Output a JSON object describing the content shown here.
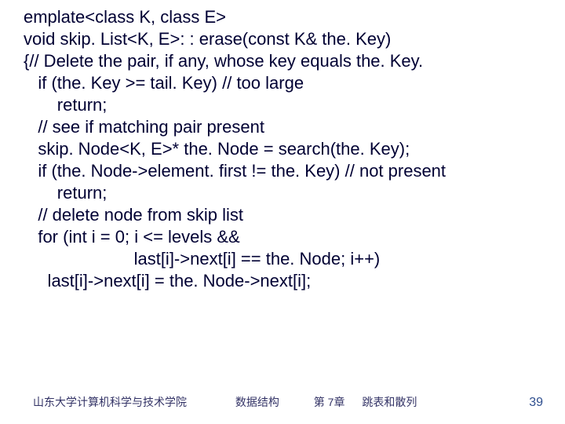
{
  "code": {
    "l01": "emplate<class K, class E>",
    "l02": "void skip. List<K, E>: : erase(const K& the. Key)",
    "l03": "{// Delete the pair, if any, whose key equals the. Key.",
    "l04": "   if (the. Key >= tail. Key) // too large",
    "l05": "       return;",
    "l06": "   // see if matching pair present",
    "l07": "   skip. Node<K, E>* the. Node = search(the. Key);",
    "l08": "   if (the. Node->element. first != the. Key) // not present",
    "l09": "       return;",
    "l10": "   // delete node from skip list",
    "l11": "   for (int i = 0; i <= levels &&",
    "l12": "                       last[i]->next[i] == the. Node; i++)",
    "l13": "     last[i]->next[i] = the. Node->next[i];"
  },
  "footer": {
    "org": "山东大学计算机科学与技术学院",
    "course": "数据结构",
    "chapter": "第 7章",
    "topic": "跳表和散列"
  },
  "page_number": "39"
}
